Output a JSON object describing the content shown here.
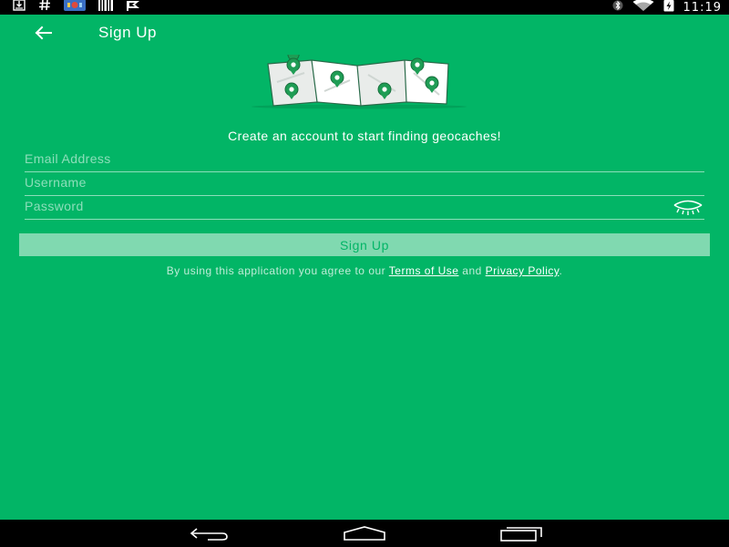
{
  "status_bar": {
    "time": "11:19",
    "left_icons": [
      "download-icon",
      "hash-icon",
      "app-notification-icon",
      "barcode-icon",
      "flag-icon"
    ],
    "right_icons": [
      "bluetooth-icon",
      "wifi-icon",
      "battery-charging-icon"
    ]
  },
  "app_bar": {
    "title": "Sign Up",
    "back_icon": "arrow-left-icon"
  },
  "tagline": "Create an account to start finding geocaches!",
  "form": {
    "email_placeholder": "Email Address",
    "email_value": "",
    "username_placeholder": "Username",
    "username_value": "",
    "password_placeholder": "Password",
    "password_value": "",
    "show_password_icon": "eye-icon"
  },
  "signup_button_label": "Sign Up",
  "legal": {
    "prefix": "By using this application you agree to our ",
    "terms_label": "Terms of Use",
    "conjunction": " and ",
    "privacy_label": "Privacy Policy",
    "suffix": "."
  },
  "nav_bar": {
    "icons": [
      "nav-back-icon",
      "nav-home-icon",
      "nav-recents-icon"
    ]
  },
  "colors": {
    "background": "#02b566",
    "button_bg": "#80d9b0",
    "button_text": "#02b566"
  }
}
